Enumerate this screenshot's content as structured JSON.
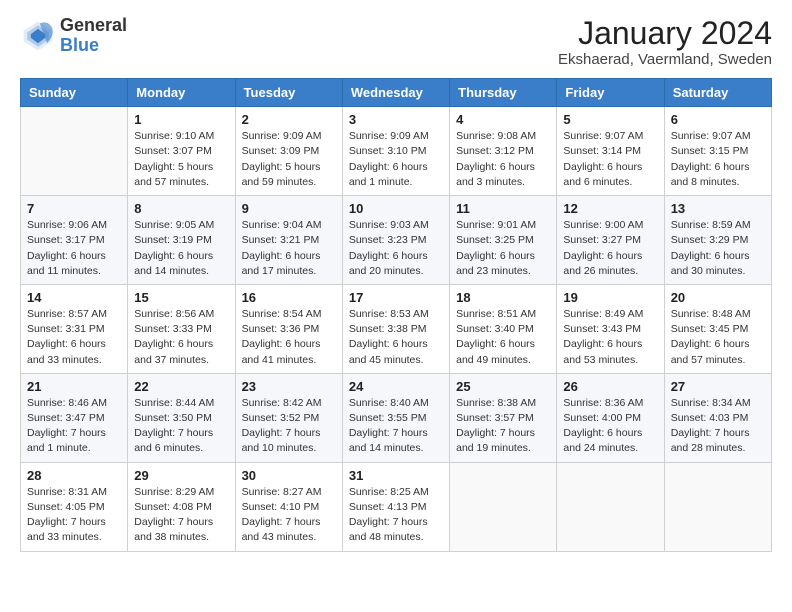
{
  "header": {
    "logo_general": "General",
    "logo_blue": "Blue",
    "title": "January 2024",
    "subtitle": "Ekshaerad, Vaermland, Sweden"
  },
  "days_of_week": [
    "Sunday",
    "Monday",
    "Tuesday",
    "Wednesday",
    "Thursday",
    "Friday",
    "Saturday"
  ],
  "weeks": [
    [
      {
        "day": "",
        "info": ""
      },
      {
        "day": "1",
        "info": "Sunrise: 9:10 AM\nSunset: 3:07 PM\nDaylight: 5 hours\nand 57 minutes."
      },
      {
        "day": "2",
        "info": "Sunrise: 9:09 AM\nSunset: 3:09 PM\nDaylight: 5 hours\nand 59 minutes."
      },
      {
        "day": "3",
        "info": "Sunrise: 9:09 AM\nSunset: 3:10 PM\nDaylight: 6 hours\nand 1 minute."
      },
      {
        "day": "4",
        "info": "Sunrise: 9:08 AM\nSunset: 3:12 PM\nDaylight: 6 hours\nand 3 minutes."
      },
      {
        "day": "5",
        "info": "Sunrise: 9:07 AM\nSunset: 3:14 PM\nDaylight: 6 hours\nand 6 minutes."
      },
      {
        "day": "6",
        "info": "Sunrise: 9:07 AM\nSunset: 3:15 PM\nDaylight: 6 hours\nand 8 minutes."
      }
    ],
    [
      {
        "day": "7",
        "info": "Sunrise: 9:06 AM\nSunset: 3:17 PM\nDaylight: 6 hours\nand 11 minutes."
      },
      {
        "day": "8",
        "info": "Sunrise: 9:05 AM\nSunset: 3:19 PM\nDaylight: 6 hours\nand 14 minutes."
      },
      {
        "day": "9",
        "info": "Sunrise: 9:04 AM\nSunset: 3:21 PM\nDaylight: 6 hours\nand 17 minutes."
      },
      {
        "day": "10",
        "info": "Sunrise: 9:03 AM\nSunset: 3:23 PM\nDaylight: 6 hours\nand 20 minutes."
      },
      {
        "day": "11",
        "info": "Sunrise: 9:01 AM\nSunset: 3:25 PM\nDaylight: 6 hours\nand 23 minutes."
      },
      {
        "day": "12",
        "info": "Sunrise: 9:00 AM\nSunset: 3:27 PM\nDaylight: 6 hours\nand 26 minutes."
      },
      {
        "day": "13",
        "info": "Sunrise: 8:59 AM\nSunset: 3:29 PM\nDaylight: 6 hours\nand 30 minutes."
      }
    ],
    [
      {
        "day": "14",
        "info": "Sunrise: 8:57 AM\nSunset: 3:31 PM\nDaylight: 6 hours\nand 33 minutes."
      },
      {
        "day": "15",
        "info": "Sunrise: 8:56 AM\nSunset: 3:33 PM\nDaylight: 6 hours\nand 37 minutes."
      },
      {
        "day": "16",
        "info": "Sunrise: 8:54 AM\nSunset: 3:36 PM\nDaylight: 6 hours\nand 41 minutes."
      },
      {
        "day": "17",
        "info": "Sunrise: 8:53 AM\nSunset: 3:38 PM\nDaylight: 6 hours\nand 45 minutes."
      },
      {
        "day": "18",
        "info": "Sunrise: 8:51 AM\nSunset: 3:40 PM\nDaylight: 6 hours\nand 49 minutes."
      },
      {
        "day": "19",
        "info": "Sunrise: 8:49 AM\nSunset: 3:43 PM\nDaylight: 6 hours\nand 53 minutes."
      },
      {
        "day": "20",
        "info": "Sunrise: 8:48 AM\nSunset: 3:45 PM\nDaylight: 6 hours\nand 57 minutes."
      }
    ],
    [
      {
        "day": "21",
        "info": "Sunrise: 8:46 AM\nSunset: 3:47 PM\nDaylight: 7 hours\nand 1 minute."
      },
      {
        "day": "22",
        "info": "Sunrise: 8:44 AM\nSunset: 3:50 PM\nDaylight: 7 hours\nand 6 minutes."
      },
      {
        "day": "23",
        "info": "Sunrise: 8:42 AM\nSunset: 3:52 PM\nDaylight: 7 hours\nand 10 minutes."
      },
      {
        "day": "24",
        "info": "Sunrise: 8:40 AM\nSunset: 3:55 PM\nDaylight: 7 hours\nand 14 minutes."
      },
      {
        "day": "25",
        "info": "Sunrise: 8:38 AM\nSunset: 3:57 PM\nDaylight: 7 hours\nand 19 minutes."
      },
      {
        "day": "26",
        "info": "Sunrise: 8:36 AM\nSunset: 4:00 PM\nDaylight: 6 hours\nand 24 minutes."
      },
      {
        "day": "27",
        "info": "Sunrise: 8:34 AM\nSunset: 4:03 PM\nDaylight: 7 hours\nand 28 minutes."
      }
    ],
    [
      {
        "day": "28",
        "info": "Sunrise: 8:31 AM\nSunset: 4:05 PM\nDaylight: 7 hours\nand 33 minutes."
      },
      {
        "day": "29",
        "info": "Sunrise: 8:29 AM\nSunset: 4:08 PM\nDaylight: 7 hours\nand 38 minutes."
      },
      {
        "day": "30",
        "info": "Sunrise: 8:27 AM\nSunset: 4:10 PM\nDaylight: 7 hours\nand 43 minutes."
      },
      {
        "day": "31",
        "info": "Sunrise: 8:25 AM\nSunset: 4:13 PM\nDaylight: 7 hours\nand 48 minutes."
      },
      {
        "day": "",
        "info": ""
      },
      {
        "day": "",
        "info": ""
      },
      {
        "day": "",
        "info": ""
      }
    ]
  ]
}
